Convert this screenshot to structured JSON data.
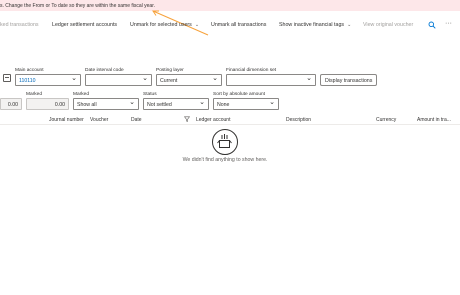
{
  "banner": {
    "message": "s. Change the From or To date so they are within the same fiscal year."
  },
  "toolbar": {
    "items": [
      {
        "label": "ked transactions",
        "disabled": true
      },
      {
        "label": "Ledger settlement accounts"
      },
      {
        "label": "Unmark for selected users"
      },
      {
        "label": "Unmark all transactions"
      },
      {
        "label": "Show inactive financial tags"
      },
      {
        "label": "View original voucher",
        "disabled": true
      }
    ],
    "search_icon": "search-icon",
    "more_icon": "more-icon"
  },
  "filters": {
    "main_account": {
      "label": "Main account",
      "value": "110110"
    },
    "date_interval_code": {
      "label": "Date interval code",
      "value": ""
    },
    "posting_layer": {
      "label": "Posting layer",
      "value": "Current"
    },
    "financial_dimension_set": {
      "label": "Financial dimension set",
      "value": ""
    },
    "display_button": "Display transactions",
    "amount_value": "0.00",
    "marked_amount": {
      "label": "Marked",
      "value": "0.00"
    },
    "marked": {
      "label": "Marked",
      "value": "Show all"
    },
    "status": {
      "label": "Status",
      "value": "Not settled"
    },
    "sort_by": {
      "label": "Sort by absolute amount",
      "value": "None"
    }
  },
  "grid": {
    "columns": [
      "Journal number",
      "Voucher",
      "Date",
      "Ledger account",
      "Description",
      "Currency",
      "Amount in tra..."
    ],
    "empty_message": "We didn't find anything to show here."
  },
  "colors": {
    "banner_bg": "#fde7e9",
    "annotation_arrow": "#f7a23b",
    "link_blue": "#0067b8",
    "accent": "#0078d4"
  }
}
